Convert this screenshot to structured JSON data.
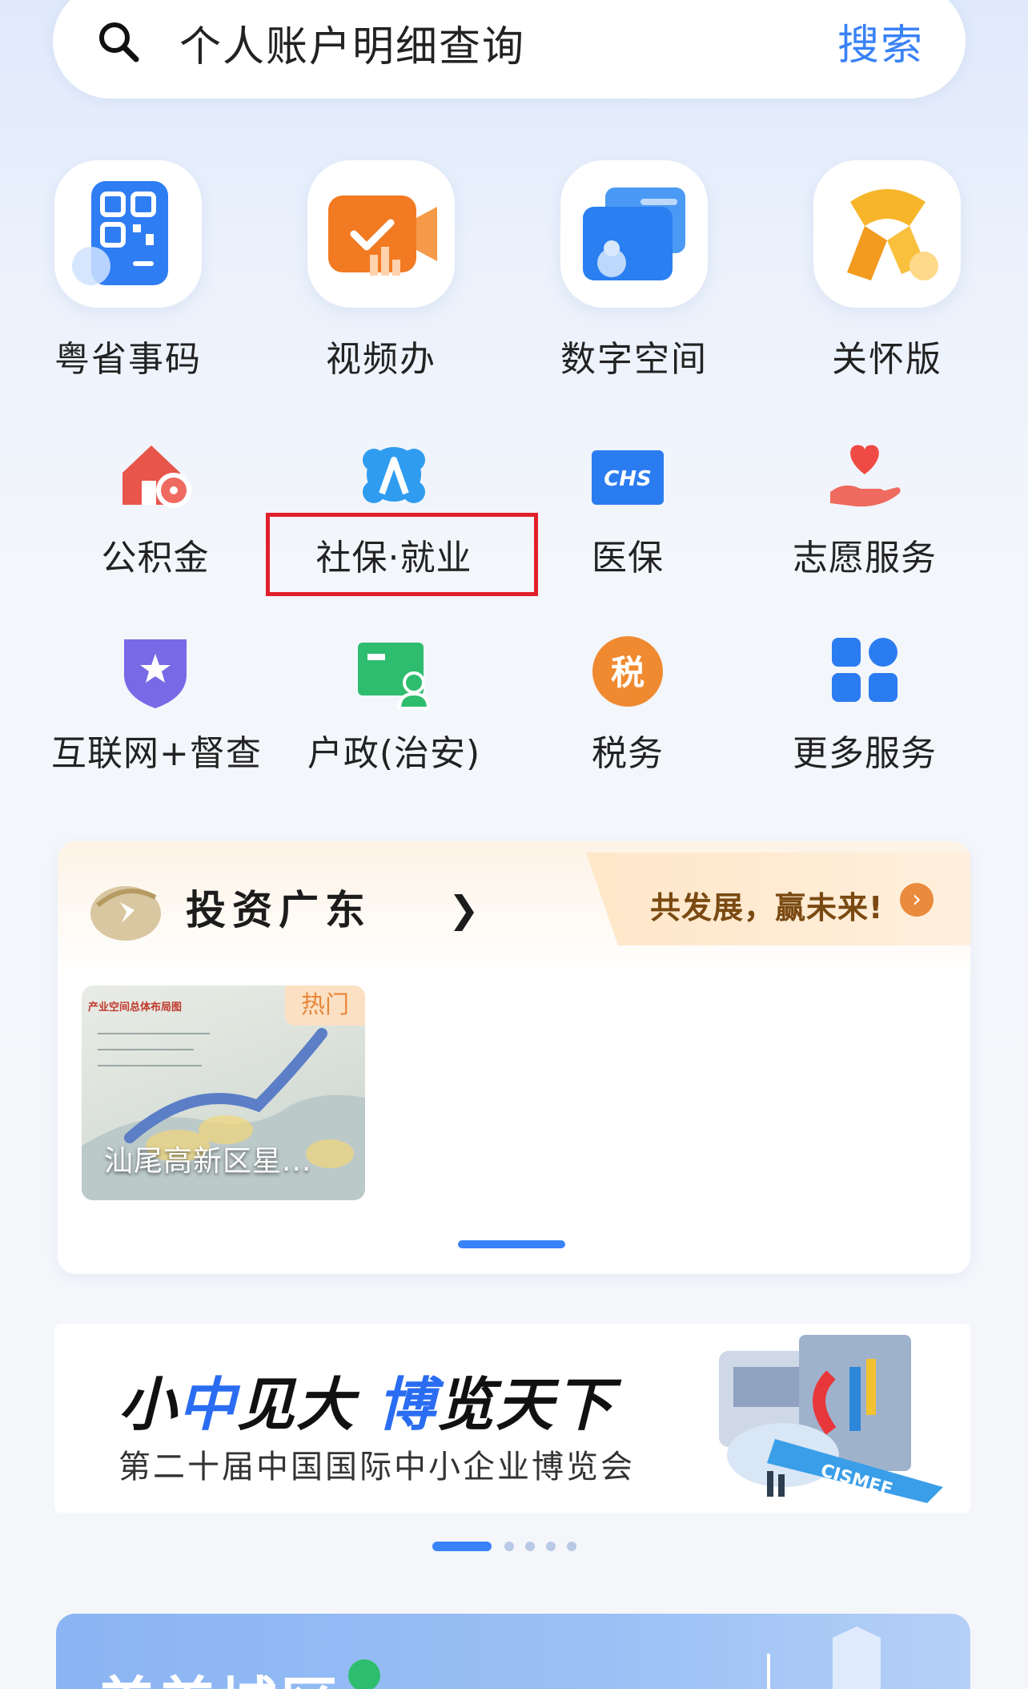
{
  "search": {
    "query": "个人账户明细查询",
    "button": "搜索",
    "icon": "search-icon"
  },
  "top_apps": [
    {
      "label": "粤省事码",
      "icon": "qr-code-icon"
    },
    {
      "label": "视频办",
      "icon": "video-camera-icon"
    },
    {
      "label": "数字空间",
      "icon": "digital-wallet-icon"
    },
    {
      "label": "关怀版",
      "icon": "care-ribbon-icon"
    }
  ],
  "services": [
    {
      "label": "公积金",
      "icon": "housing-fund-icon",
      "color": "#e8554b"
    },
    {
      "label": "社保·就业",
      "icon": "social-security-icon",
      "color": "#2f9cf0"
    },
    {
      "label": "医保",
      "icon": "chs-badge-icon",
      "color": "#2b7cf0"
    },
    {
      "label": "志愿服务",
      "icon": "heart-hand-icon",
      "color": "#ef4b44"
    },
    {
      "label": "互联网+督查",
      "icon": "shield-star-icon",
      "color": "#7869e6"
    },
    {
      "label": "户政(治安)",
      "icon": "id-card-icon",
      "color": "#2ebd6e"
    },
    {
      "label": "税务",
      "icon": "tax-icon",
      "color": "#f08a30"
    },
    {
      "label": "更多服务",
      "icon": "grid-more-icon",
      "color": "#2b7cf0"
    }
  ],
  "invest": {
    "title": "投资广东",
    "slogan": "共发展，赢未来!",
    "thumb_tag": "热门",
    "thumb_header": "产业空间总体布局图",
    "thumb_caption": "汕尾高新区星..."
  },
  "banner": {
    "headline_1": "小",
    "headline_2": "中",
    "headline_3": "见大 ",
    "headline_4": "博",
    "headline_5": "览天下",
    "sub": "第二十届中国国际中小企业博览会",
    "art_text": "CISMEF"
  },
  "bottom": {
    "title": "美美城区"
  },
  "colors": {
    "accent": "#3a82f7",
    "highlight": "#e0202a"
  }
}
